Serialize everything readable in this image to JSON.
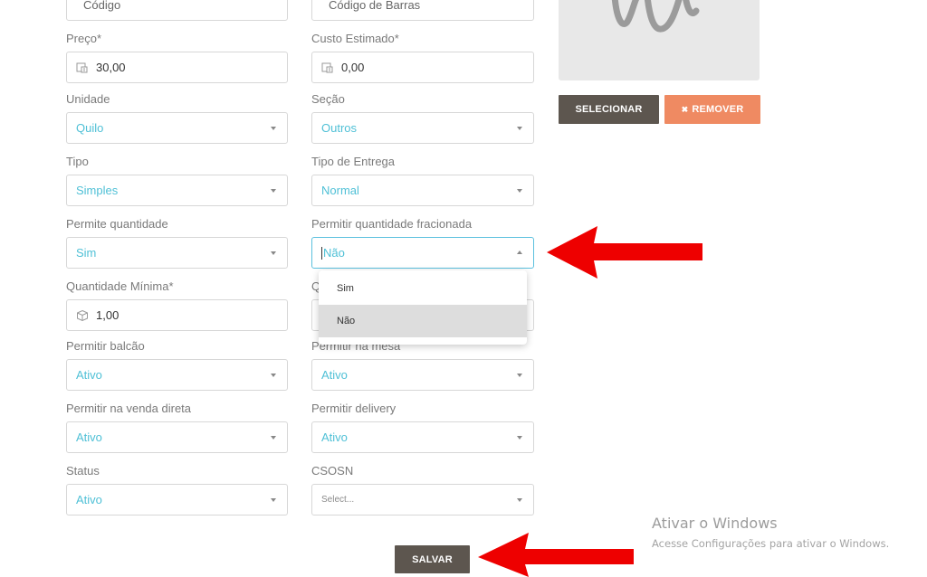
{
  "form": {
    "codigo": {
      "value": "Código"
    },
    "codigo_barras": {
      "value": "Código de Barras"
    },
    "preco": {
      "label": "Preço*",
      "value": "30,00",
      "icon": "price-tag-icon"
    },
    "custo": {
      "label": "Custo Estimado*",
      "value": "0,00",
      "icon": "price-tag-icon"
    },
    "unidade": {
      "label": "Unidade",
      "value": "Quilo"
    },
    "secao": {
      "label": "Seção",
      "value": "Outros"
    },
    "tipo": {
      "label": "Tipo",
      "value": "Simples"
    },
    "tipo_entrega": {
      "label": "Tipo de Entrega",
      "value": "Normal"
    },
    "permite_quantidade": {
      "label": "Permite quantidade",
      "value": "Sim"
    },
    "permitir_fracionada": {
      "label": "Permitir quantidade fracionada",
      "value": "Não",
      "options": [
        "Sim",
        "Não"
      ],
      "highlighted": "Não"
    },
    "quantidade_minima": {
      "label": "Quantidade Mínima*",
      "value": "1,00",
      "icon": "box-icon"
    },
    "hidden_label_initial": "Q",
    "permitir_balcao": {
      "label": "Permitir balcão",
      "value": "Ativo"
    },
    "permitir_mesa": {
      "label": "Permitir na mesa",
      "value": "Ativo"
    },
    "permitir_venda_direta": {
      "label": "Permitir na venda direta",
      "value": "Ativo"
    },
    "permitir_delivery": {
      "label": "Permitir delivery",
      "value": "Ativo"
    },
    "status": {
      "label": "Status",
      "value": "Ativo"
    },
    "csosn": {
      "label": "CSOSN",
      "placeholder": "Select..."
    }
  },
  "image_panel": {
    "select_label": "SELECIONAR",
    "remove_label": "REMOVER",
    "remove_icon": "x-icon"
  },
  "save_label": "SALVAR",
  "windows_watermark": {
    "title": "Ativar o Windows",
    "subtitle": "Acesse Configurações para ativar o Windows."
  },
  "colors": {
    "accent_value": "#4fc0d6",
    "button_dark": "#5d564f",
    "button_orange": "#ef8a62",
    "annotation_arrow": "#ee0000"
  }
}
